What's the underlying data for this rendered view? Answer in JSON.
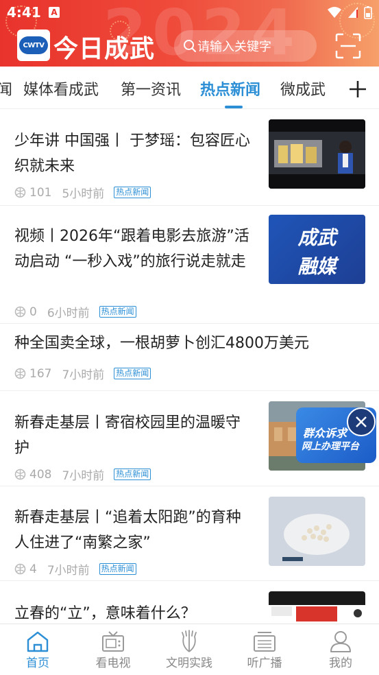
{
  "status_bar": {
    "time": "4:41",
    "notification": "A"
  },
  "header": {
    "logo_text": "CWTV",
    "title": "今日成武",
    "background_year": "2024",
    "search_placeholder": "请输入关键字",
    "accent_color": "#e8332c"
  },
  "tabs": {
    "items": [
      {
        "label": "闻"
      },
      {
        "label": "媒体看成武"
      },
      {
        "label": "第一资讯"
      },
      {
        "label": "热点新闻",
        "active": true
      },
      {
        "label": "微成武"
      }
    ],
    "active_color": "#2c8fd6"
  },
  "feed": [
    {
      "title": "少年讲  中国强丨  于梦瑶：包容匠心  织就未来",
      "views": "101",
      "time": "5小时前",
      "tag": "热点新闻",
      "thumb": "video-studio"
    },
    {
      "title": "视频丨2026年“跟着电影去旅游”活动启动  “一秒入戏”的旅行说走就走",
      "views": "0",
      "time": "6小时前",
      "tag": "热点新闻",
      "thumb_text": [
        "成武",
        "融媒"
      ]
    },
    {
      "title": "种全国卖全球，一根胡萝卜创汇4800万美元",
      "views": "167",
      "time": "7小时前",
      "tag": "热点新闻"
    },
    {
      "title": "新春走基层丨寄宿校园里的温暖守护",
      "views": "408",
      "time": "7小时前",
      "tag": "热点新闻",
      "thumb": "school"
    },
    {
      "title": "新春走基层丨“追着太阳跑”的育种人住进了“南繁之家”",
      "views": "4",
      "time": "7小时前",
      "tag": "热点新闻",
      "thumb": "seeds"
    },
    {
      "title": "立春的“立”，意味着什么？",
      "thumb": "document"
    }
  ],
  "floating": {
    "line1": "群众诉求",
    "line2": "网上办理平台"
  },
  "bottom_nav": [
    {
      "label": "首页",
      "icon": "home-icon",
      "active": true
    },
    {
      "label": "看电视",
      "icon": "tv-icon"
    },
    {
      "label": "文明实践",
      "icon": "hand-icon"
    },
    {
      "label": "听广播",
      "icon": "radio-icon"
    },
    {
      "label": "我的",
      "icon": "user-icon"
    }
  ]
}
